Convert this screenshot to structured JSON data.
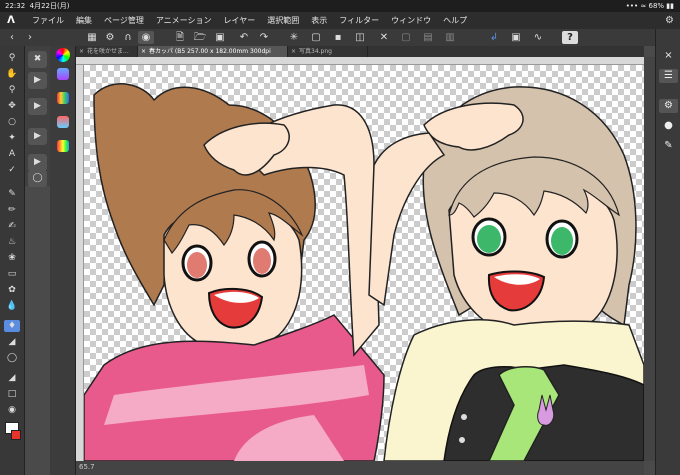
{
  "status": {
    "time": "22:32",
    "date": "4月22日(月)",
    "battery": "68%"
  },
  "menu": [
    "ファイル",
    "編集",
    "ページ管理",
    "アニメーション",
    "レイヤー",
    "選択範囲",
    "表示",
    "フィルター",
    "ウィンドウ",
    "ヘルプ"
  ],
  "tabs": [
    {
      "label": "花を咲かせま..."
    },
    {
      "label": "春カッパ (B5 257.00 x 182.00mm 300dpi 65.7%)"
    },
    {
      "label": "写真34.png"
    }
  ],
  "zoom": "65.7",
  "colors": {
    "main": "#ffffff",
    "sub": "#e8322c",
    "accent": "#5a8ce0"
  }
}
